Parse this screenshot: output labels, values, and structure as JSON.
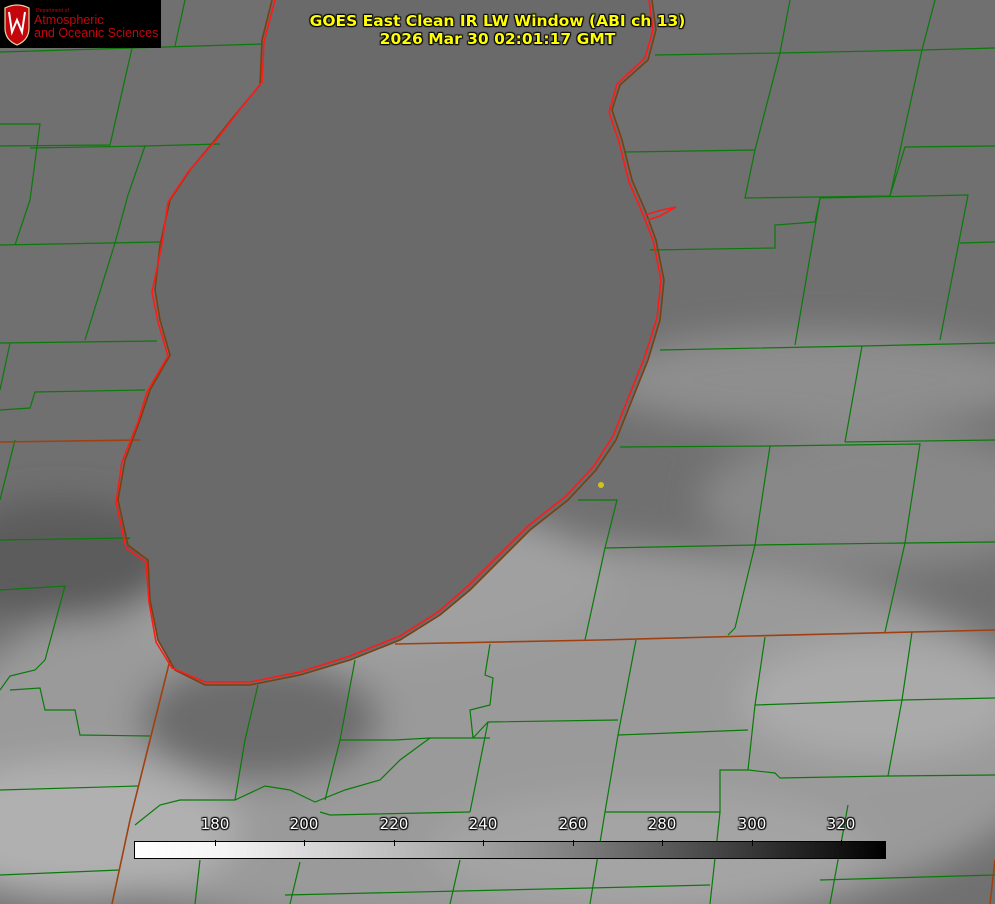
{
  "header": {
    "title_line1": "GOES East Clean IR LW Window (ABI ch 13)",
    "title_line2": "2026 Mar 30 02:01:17 GMT",
    "title_color": "#ffff00"
  },
  "logo": {
    "department": "Department of",
    "line1": "Atmospheric",
    "line2": "and Oceanic Sciences",
    "seal_letter": "W",
    "brand_color": "#c5050c"
  },
  "colorbar": {
    "units": "",
    "min": 162,
    "max": 330,
    "ticks": [
      180,
      200,
      220,
      240,
      260,
      280,
      300,
      320
    ]
  },
  "map": {
    "county_line_color": "#0a7a0a",
    "state_line_color": "#a04010",
    "lake_shore_color": "#ff1a1a",
    "marker_color": "#d4c21a"
  }
}
